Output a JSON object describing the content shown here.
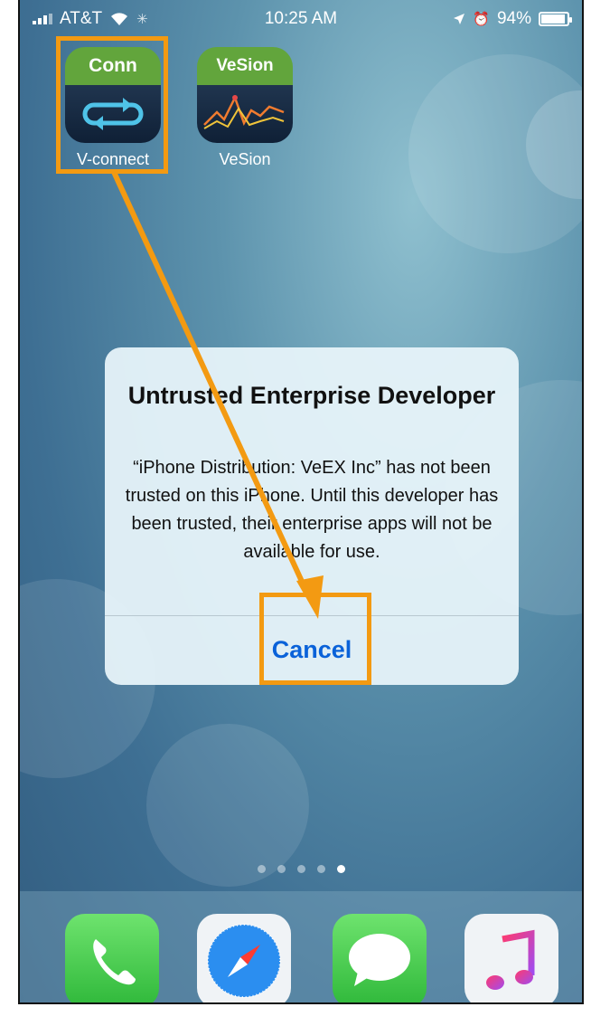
{
  "status_bar": {
    "carrier": "AT&T",
    "time": "10:25 AM",
    "battery_percent": "94%",
    "battery_level": 0.94,
    "icons": [
      "signal-bars-icon",
      "wifi-icon",
      "activity-spinner-icon",
      "location-arrow-icon",
      "alarm-icon",
      "battery-icon"
    ]
  },
  "home_apps": [
    {
      "label": "V-connect",
      "icon_text": "Conn",
      "icon": "sync-arrows-icon"
    },
    {
      "label": "VeSion",
      "icon_text": "VeSion",
      "icon": "line-graph-icon"
    }
  ],
  "alert": {
    "title": "Untrusted Enterprise Developer",
    "message": "“iPhone Distribution: VeEX Inc” has not been trusted on this iPhone. Until this developer has been trusted, their enterprise apps will not be available for use.",
    "cancel_label": "Cancel"
  },
  "page_indicator": {
    "count": 5,
    "active": 5
  },
  "dock": {
    "apps": [
      "phone-icon",
      "safari-icon",
      "messages-icon",
      "music-icon"
    ]
  },
  "annotation": {
    "color": "#f39a12"
  }
}
